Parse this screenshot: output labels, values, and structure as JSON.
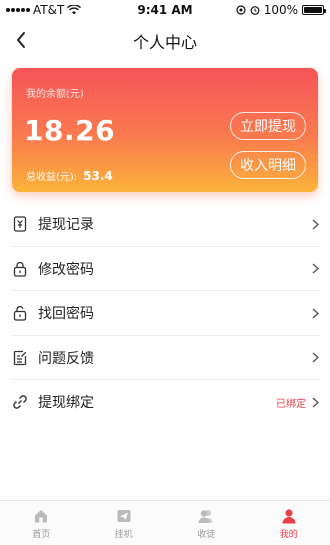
{
  "status_bar": {
    "carrier": "AT&T",
    "time": "9:41 AM",
    "battery": "100%"
  },
  "nav": {
    "title": "个人中心",
    "back_icon": "chevron-left-icon"
  },
  "balance_card": {
    "label": "我的余额(元)",
    "amount": "18.26",
    "total_label": "总收益(元):",
    "total_value": "53.4",
    "withdraw_button": "立即提现",
    "detail_button": "收入明细",
    "gradient": [
      "#f6545a",
      "#f97a4e",
      "#fcb33b"
    ]
  },
  "menu": {
    "items": [
      {
        "label": "提现记录",
        "icon": "withdraw-record-icon",
        "status": ""
      },
      {
        "label": "修改密码",
        "icon": "lock-icon",
        "status": ""
      },
      {
        "label": "找回密码",
        "icon": "unlock-icon",
        "status": ""
      },
      {
        "label": "问题反馈",
        "icon": "feedback-icon",
        "status": ""
      },
      {
        "label": "提现绑定",
        "icon": "link-icon",
        "status": "已绑定"
      }
    ]
  },
  "tab_bar": {
    "tabs": [
      {
        "label": "首页",
        "icon": "home-icon",
        "active": false
      },
      {
        "label": "挂机",
        "icon": "send-icon",
        "active": false
      },
      {
        "label": "收徒",
        "icon": "users-icon",
        "active": false
      },
      {
        "label": "我的",
        "icon": "user-icon",
        "active": true
      }
    ],
    "active_color": "#e8414a",
    "inactive_color": "#999999"
  }
}
